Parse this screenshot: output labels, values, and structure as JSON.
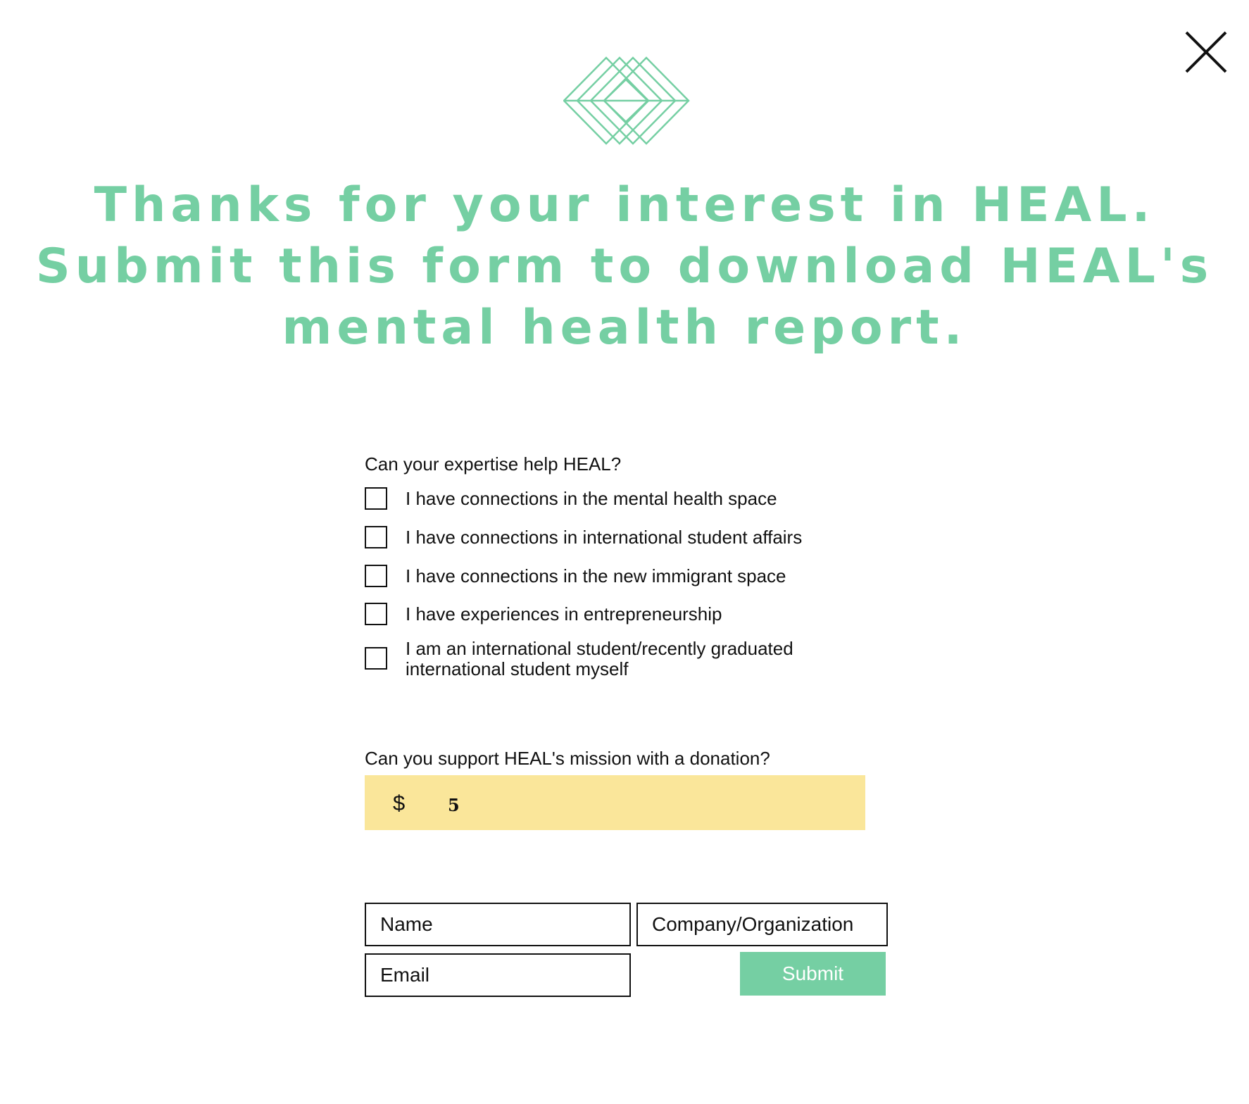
{
  "modal": {
    "close_icon": "close-icon",
    "logo_icon": "heal-diamond-logo-icon",
    "headline_lines": [
      "Thanks for your interest in HEAL.",
      "Submit this form to download HEAL's",
      "mental health report."
    ]
  },
  "colors": {
    "brand_green": "#75cfa3",
    "donation_bg": "#fae69a"
  },
  "expertise": {
    "question": "Can your expertise help HEAL?",
    "options": [
      {
        "label": "I have connections in the mental health space",
        "checked": false
      },
      {
        "label": "I have connections in international student affairs",
        "checked": false
      },
      {
        "label": "I have connections in the new immigrant space",
        "checked": false
      },
      {
        "label": "I have experiences in entrepreneurship",
        "checked": false
      },
      {
        "label": "I am an international student/recently graduated international student myself",
        "checked": false
      }
    ]
  },
  "donation": {
    "question": "Can you support HEAL's mission with a donation?",
    "currency": "$",
    "amount": "5"
  },
  "contact": {
    "name_placeholder": "Name",
    "company_placeholder": "Company/Organization",
    "email_placeholder": "Email",
    "submit_label": "Submit"
  }
}
